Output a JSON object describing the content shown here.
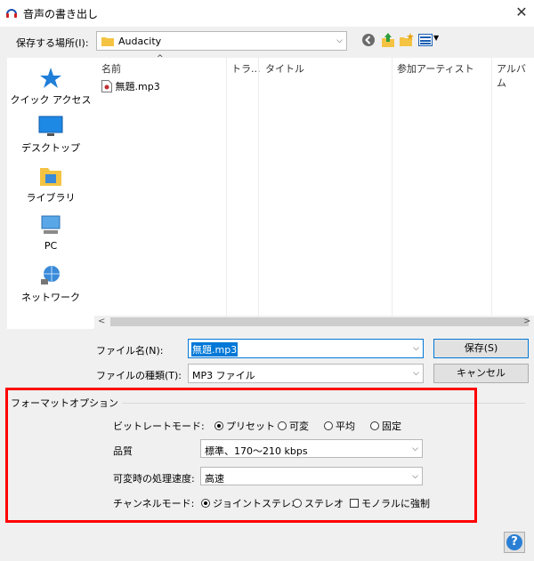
{
  "window": {
    "title": "音声の書き出し",
    "close": "✕"
  },
  "location": {
    "label": "保存する場所(I):",
    "value": "Audacity"
  },
  "sidebar": {
    "items": [
      {
        "label": "クイック アクセス"
      },
      {
        "label": "デスクトップ"
      },
      {
        "label": "ライブラリ"
      },
      {
        "label": "PC"
      },
      {
        "label": "ネットワーク"
      }
    ]
  },
  "list": {
    "columns": [
      "名前",
      "トラ...",
      "タイトル",
      "参加アーティスト",
      "アルバム"
    ],
    "files": [
      {
        "name": "無題.mp3"
      }
    ]
  },
  "filename": {
    "label": "ファイル名(N):",
    "value": "無題.mp3"
  },
  "filetype": {
    "label": "ファイルの種類(T):",
    "value": "MP3 ファイル"
  },
  "buttons": {
    "save": "保存(S)",
    "cancel": "キャンセル",
    "help": "?"
  },
  "format": {
    "group_label": "フォーマットオプション",
    "bitrate_mode": {
      "label": "ビットレートモード:",
      "options": [
        "プリセット",
        "可変",
        "平均",
        "固定"
      ],
      "selected": "プリセット"
    },
    "quality": {
      "label": "品質",
      "value": "標準、170〜210 kbps"
    },
    "vbr_speed": {
      "label": "可変時の処理速度:",
      "value": "高速"
    },
    "channel_mode": {
      "label": "チャンネルモード:",
      "options": [
        "ジョイントステレオ",
        "ステレオ"
      ],
      "selected": "ジョイントステレオ",
      "force_mono": "モノラルに強制"
    }
  }
}
